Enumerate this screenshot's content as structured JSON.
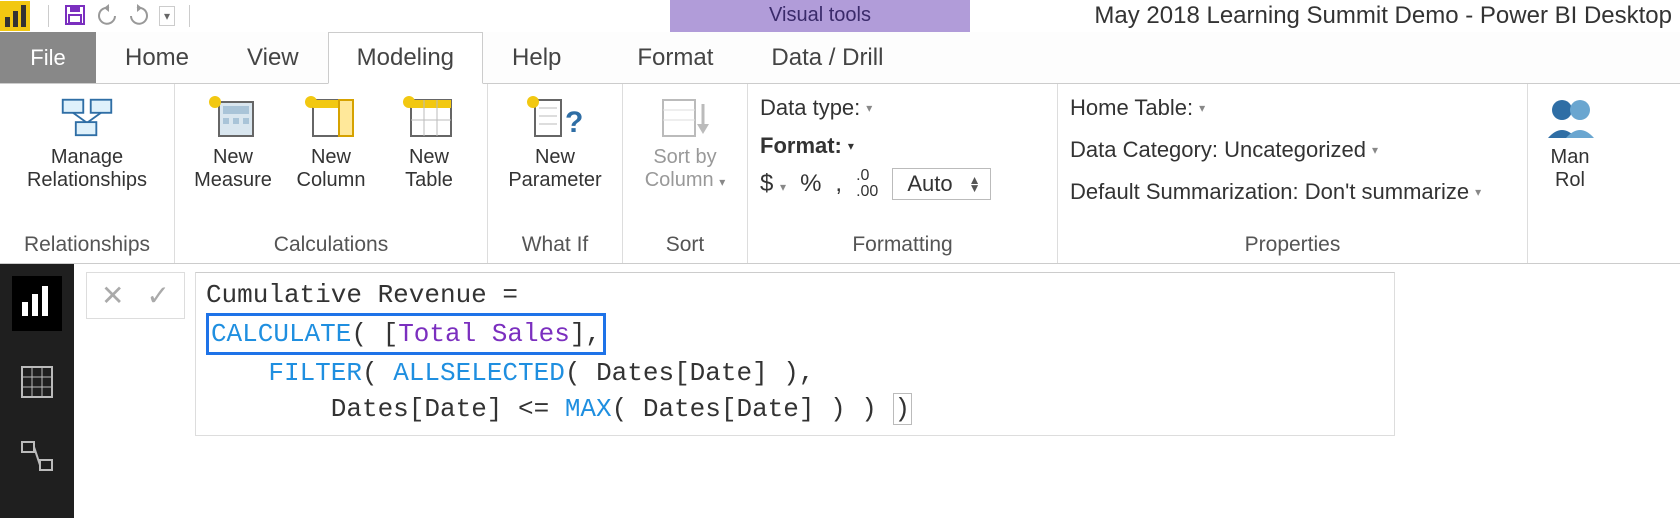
{
  "titlebar": {
    "contextual_label": "Visual tools",
    "window_title": "May 2018 Learning Summit Demo - Power BI Desktop"
  },
  "tabs": {
    "file": "File",
    "items": [
      "Home",
      "View",
      "Modeling",
      "Help",
      "Format",
      "Data / Drill"
    ],
    "active": "Modeling"
  },
  "ribbon": {
    "relationships": {
      "btn": "Manage\nRelationships",
      "group": "Relationships"
    },
    "calculations": {
      "measure": "New\nMeasure",
      "column": "New\nColumn",
      "table": "New\nTable",
      "group": "Calculations"
    },
    "whatif": {
      "btn": "New\nParameter",
      "group": "What If"
    },
    "sort": {
      "btn": "Sort by\nColumn",
      "group": "Sort"
    },
    "formatting": {
      "data_type_label": "Data type:",
      "format_label": "Format:",
      "currency": "$",
      "percent": "%",
      "thousand": ",",
      "decimals_icon": ".00",
      "auto": "Auto",
      "group": "Formatting"
    },
    "properties": {
      "home_table": "Home Table:",
      "data_category": "Data Category: Uncategorized",
      "default_summarization": "Default Summarization: Don't summarize",
      "group": "Properties"
    },
    "security": {
      "btn": "Man\nRol"
    }
  },
  "formula": {
    "line1_name": "Cumulative Revenue",
    "calc": "CALCULATE",
    "total_sales": "Total Sales",
    "filter": "FILTER",
    "allselected": "ALLSELECTED",
    "dates_date": "Dates[Date]",
    "max": "MAX"
  }
}
